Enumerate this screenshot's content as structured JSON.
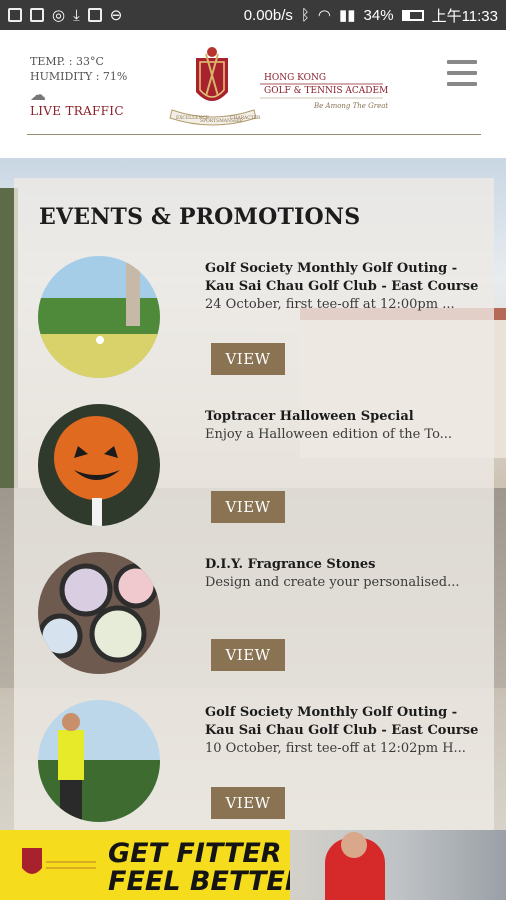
{
  "status_bar": {
    "speed": "0.00b/s",
    "battery": "34%",
    "time": "上午11:33"
  },
  "header": {
    "temp": "TEMP. : 33°C",
    "humidity": "HUMIDITY : 71%",
    "live_traffic": "LIVE TRAFFIC",
    "logo_line1": "HONG KONG",
    "logo_line2": "GOLF & TENNIS ACADEMY",
    "logo_tagline": "Be Among The Greats",
    "logo_ribbon_left": "EXCELLENCE",
    "logo_ribbon_mid": "SPORTSMANSHIP",
    "logo_ribbon_right": "CHARACTER"
  },
  "section": {
    "title": "EVENTS & PROMOTIONS"
  },
  "events": [
    {
      "title": "Golf Society Monthly Golf Outing - Kau Sai Chau Golf Club - East Course",
      "desc": "24 October, first tee-off at 12:00pm ...",
      "button": "VIEW",
      "image_icon": "golf-putt-photo"
    },
    {
      "title": "Toptracer Halloween Special",
      "desc": "Enjoy a Halloween edition of the To...",
      "button": "VIEW",
      "image_icon": "halloween-golf-ball-photo"
    },
    {
      "title": "D.I.Y. Fragrance Stones",
      "desc": "Design and create your personalised...",
      "button": "VIEW",
      "image_icon": "fragrance-stones-photo"
    },
    {
      "title": "Golf Society Monthly Golf Outing - Kau Sai Chau Golf Club - East Course",
      "desc": "10 October, first tee-off at 12:02pm H...",
      "button": "VIEW",
      "image_icon": "golfer-swing-photo"
    }
  ],
  "banner": {
    "line1": "GET FITTER",
    "line2": "FEEL BETTER"
  },
  "colors": {
    "accent": "#8a7352",
    "brand_red": "#8b1f2a",
    "banner_yellow": "#f5dc1c"
  }
}
